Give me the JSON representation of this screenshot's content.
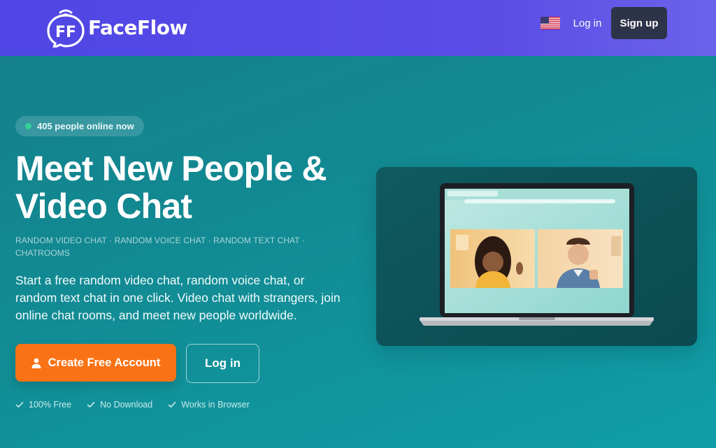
{
  "header": {
    "brand_monogram": "FF",
    "brand_name": "FaceFlow",
    "language_flag": "us-flag-icon",
    "login_label": "Log in",
    "signup_label": "Sign up"
  },
  "hero": {
    "online_badge": "405 people online now",
    "headline_line1": "Meet New People &",
    "headline_line2": "Video Chat",
    "tagline": "RANDOM VIDEO CHAT · RANDOM VOICE CHAT · RANDOM TEXT CHAT · CHATROOMS",
    "description": "Start a free random video chat, random voice chat, or random text chat in one click. Video chat with strangers, join online chat rooms, and meet new people worldwide.",
    "cta_create_label": "Create Free Account",
    "cta_login_label": "Log in",
    "features": [
      "100% Free",
      "No Download",
      "Works in Browser"
    ]
  },
  "colors": {
    "header_bg": "#4f46e5",
    "signup_bg": "#2d3348",
    "cta_orange": "#f97316",
    "online_dot": "#34d399",
    "hero_teal": "#128a93"
  }
}
